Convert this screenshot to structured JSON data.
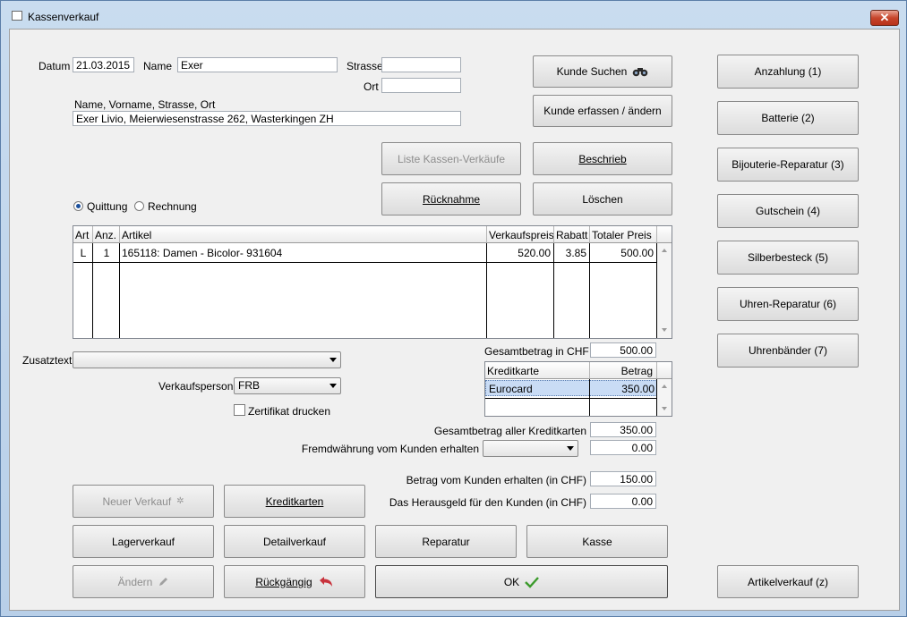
{
  "window": {
    "title": "Kassenverkauf"
  },
  "customer": {
    "datum_label": "Datum",
    "datum_value": "21.03.2015",
    "name_label": "Name",
    "name_value": "Exer",
    "strasse_label": "Strasse",
    "strasse_value": "",
    "ort_label": "Ort",
    "ort_value": "",
    "full_label": "Name, Vorname, Strasse, Ort",
    "full_value": "Exer Livio, Meierwiesenstrasse 262, Wasterkingen ZH"
  },
  "buttons_top": {
    "kunde_suchen": "Kunde Suchen",
    "kunde_erfassen": "Kunde erfassen / ändern",
    "liste": "Liste Kassen-Verkäufe",
    "beschrieb": "Beschrieb",
    "ruecknahme": "Rücknahme",
    "loeschen": "Löschen"
  },
  "doc_type": {
    "quittung": "Quittung",
    "rechnung": "Rechnung",
    "selected": "quittung"
  },
  "table": {
    "columns": [
      "Art",
      "Anz.",
      "Artikel",
      "Verkaufspreis",
      "Rabatt",
      "Totaler Preis"
    ],
    "rows": [
      {
        "art": "L",
        "anz": "1",
        "artikel": "165118: Damen - Bicolor- 931604",
        "verkaufspreis": "520.00",
        "rabatt": "3.85",
        "total": "500.00"
      }
    ]
  },
  "zusatz": {
    "label": "Zusatztext",
    "value": ""
  },
  "verkaufsperson": {
    "label": "Verkaufsperson",
    "value": "FRB"
  },
  "zertifikat": {
    "label": "Zertifikat drucken",
    "checked": false
  },
  "totals": {
    "gesamt_label": "Gesamtbetrag in CHF",
    "gesamt_value": "500.00",
    "kk_gesamt_label": "Gesamtbetrag aller Kreditkarten",
    "kk_gesamt_value": "350.00",
    "fremd_label": "Fremdwährung vom Kunden erhalten",
    "fremd_currency": "",
    "fremd_value": "0.00",
    "erhalten_label": "Betrag vom Kunden erhalten (in CHF)",
    "erhalten_value": "150.00",
    "herausgeld_label": "Das Herausgeld für den Kunden (in CHF)",
    "herausgeld_value": "0.00"
  },
  "cards": {
    "columns": [
      "Kreditkarte",
      "Betrag"
    ],
    "rows": [
      {
        "karte": "Eurocard",
        "betrag": "350.00"
      }
    ]
  },
  "right_buttons": [
    "Anzahlung (1)",
    "Batterie (2)",
    "Bijouterie-Reparatur (3)",
    "Gutschein (4)",
    "Silberbesteck (5)",
    "Uhren-Reparatur (6)",
    "Uhrenbänder (7)"
  ],
  "bottom_buttons": {
    "neuer_verkauf": "Neuer Verkauf",
    "kreditkarten": "Kreditkarten",
    "lagerverkauf": "Lagerverkauf",
    "detailverkauf": "Detailverkauf",
    "reparatur": "Reparatur",
    "kasse": "Kasse",
    "aendern": "Ändern",
    "rueckgaengig": "Rückgängig",
    "ok": "OK",
    "artikelverkauf": "Artikelverkauf (z)"
  },
  "colors": {
    "selection": "#c9dcf5",
    "accent_green": "#3a9a2a",
    "undo_red": "#c8323c"
  }
}
